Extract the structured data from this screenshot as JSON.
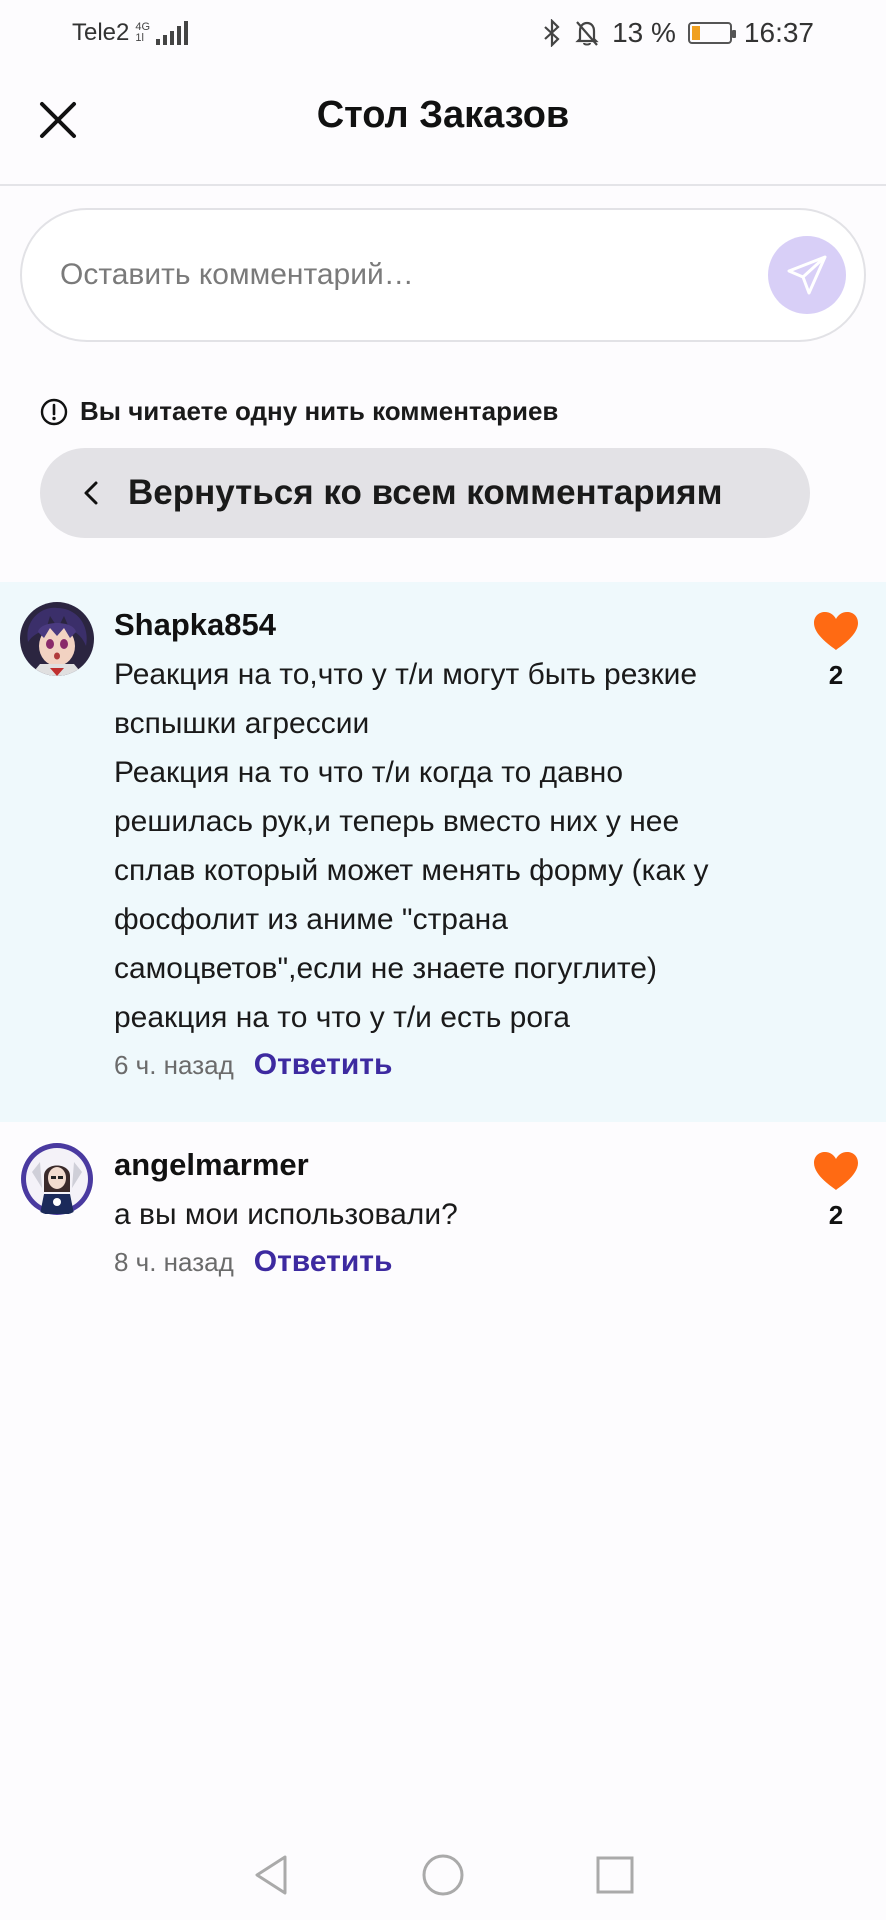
{
  "status_bar": {
    "carrier": "Tele2",
    "network_top": "4G",
    "network_bottom": "1l",
    "battery_percent": "13 %",
    "time": "16:37"
  },
  "header": {
    "title": "Стол Заказов"
  },
  "comment_input": {
    "placeholder": "Оставить комментарий…"
  },
  "thread": {
    "notice": "Вы читаете одну нить комментариев",
    "back_label": "Вернуться ко всем комментариям"
  },
  "comments": [
    {
      "username": "Shapka854",
      "text": "Реакция на то,что у т/и могут быть резкие\nвспышки агрессии\nРеакция на то что т/и когда то давно\nрешилась рук,и теперь вместо них у нее\nсплав который может менять форму (как у\nфосфолит из аниме \"страна\nсамоцветов\",если не знаете погуглите)\nреакция на то что у т/и есть рога",
      "time": "6 ч. назад",
      "reply_label": "Ответить",
      "likes": "2"
    },
    {
      "username": "angelmarmer",
      "text": "а вы мои использовали?",
      "time": "8 ч. назад",
      "reply_label": "Ответить",
      "likes": "2"
    }
  ],
  "colors": {
    "accent": "#3d2aa0",
    "heart": "#ff6a13",
    "send_button": "#d8cff7",
    "highlight": "#eff9fc"
  }
}
